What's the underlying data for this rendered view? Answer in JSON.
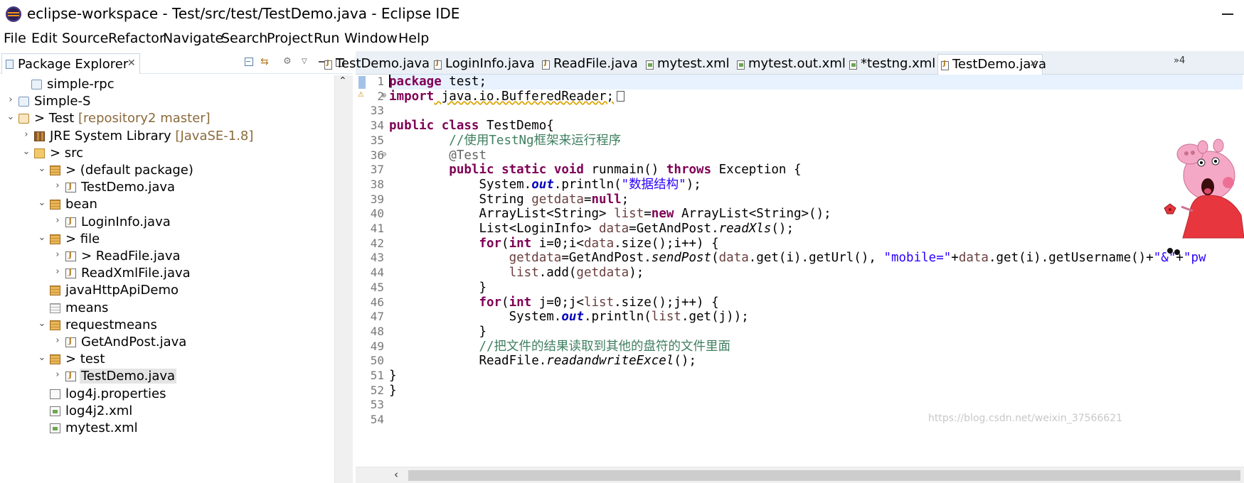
{
  "window": {
    "title": "eclipse-workspace - Test/src/test/TestDemo.java - Eclipse IDE"
  },
  "menu": [
    "File",
    "Edit",
    "Source",
    "Refactor",
    "Navigate",
    "Search",
    "Project",
    "Run",
    "Window",
    "Help"
  ],
  "explorer": {
    "tab_label": "Package Explorer",
    "close_glyph": "✕",
    "tree": [
      {
        "arrow": "",
        "label": "simple-rpc",
        "decor": "",
        "icon": "project"
      },
      {
        "arrow": "›",
        "label": "Simple-S",
        "decor": "",
        "icon": "project"
      },
      {
        "arrow": "⌄",
        "label": "> Test",
        "decor": " [repository2 master]",
        "icon": "project-git"
      },
      {
        "arrow": "›",
        "label": "JRE System Library",
        "decor": " [JavaSE-1.8]",
        "icon": "library"
      },
      {
        "arrow": "⌄",
        "label": "> src",
        "decor": "",
        "icon": "folder"
      },
      {
        "arrow": "⌄",
        "label": "> (default package)",
        "decor": "",
        "icon": "package"
      },
      {
        "arrow": "›",
        "label": "TestDemo.java",
        "decor": "",
        "icon": "java"
      },
      {
        "arrow": "⌄",
        "label": "bean",
        "decor": "",
        "icon": "package"
      },
      {
        "arrow": "›",
        "label": "LoginInfo.java",
        "decor": "",
        "icon": "java"
      },
      {
        "arrow": "⌄",
        "label": "> file",
        "decor": "",
        "icon": "package"
      },
      {
        "arrow": "›",
        "label": "> ReadFile.java",
        "decor": "",
        "icon": "java"
      },
      {
        "arrow": "›",
        "label": "ReadXmlFile.java",
        "decor": "",
        "icon": "java"
      },
      {
        "arrow": "",
        "label": "javaHttpApiDemo",
        "decor": "",
        "icon": "package"
      },
      {
        "arrow": "",
        "label": "means",
        "decor": "",
        "icon": "package-empty"
      },
      {
        "arrow": "⌄",
        "label": "requestmeans",
        "decor": "",
        "icon": "package"
      },
      {
        "arrow": "›",
        "label": "GetAndPost.java",
        "decor": "",
        "icon": "java"
      },
      {
        "arrow": "⌄",
        "label": "> test",
        "decor": "",
        "icon": "package"
      },
      {
        "arrow": "›",
        "label": "TestDemo.java",
        "decor": "",
        "icon": "java",
        "selected": true
      },
      {
        "arrow": "",
        "label": "log4j.properties",
        "decor": "",
        "icon": "file"
      },
      {
        "arrow": "",
        "label": "log4j2.xml",
        "decor": "",
        "icon": "xml"
      },
      {
        "arrow": "",
        "label": "mytest.xml",
        "decor": "",
        "icon": "xml"
      }
    ]
  },
  "editor": {
    "tabs": [
      {
        "label": "TestDemo.java",
        "icon": "java",
        "active": false
      },
      {
        "label": "LoginInfo.java",
        "icon": "java",
        "active": false
      },
      {
        "label": "ReadFile.java",
        "icon": "java",
        "active": false
      },
      {
        "label": "mytest.xml",
        "icon": "xml",
        "active": false
      },
      {
        "label": "mytest.out.xml",
        "icon": "xml",
        "active": false
      },
      {
        "label": "*testng.xml",
        "icon": "xml",
        "active": false
      },
      {
        "label": "TestDemo.java",
        "icon": "java",
        "active": true
      }
    ],
    "more_tabs": "»4",
    "line_numbers": [
      "1",
      "2",
      "33",
      "34",
      "35",
      "36",
      "37",
      "38",
      "39",
      "40",
      "41",
      "42",
      "43",
      "44",
      "45",
      "46",
      "47",
      "48",
      "49",
      "50",
      "51",
      "52",
      "53",
      "54"
    ],
    "code": {
      "l1_kw": "package",
      "l1_rest": " test;",
      "l2_kw": "import",
      "l2_rest": " java.io.BufferedReader;",
      "l34_kw1": "public",
      "l34_kw2": "class",
      "l34_rest": " TestDemo{",
      "l35_comment": "//使用TestNg框架来运行程序",
      "l36_annot": "@Test",
      "l37_kw1": "public",
      "l37_kw2": "static",
      "l37_kw3": "void",
      "l37_mid": " runmain() ",
      "l37_kw4": "throws",
      "l37_rest": " Exception {",
      "l38_a": "System.",
      "l38_field": "out",
      "l38_b": ".println(",
      "l38_str": "\"数据结构\"",
      "l38_c": ");",
      "l39_a": "String ",
      "l39_var": "getdata",
      "l39_b": "=",
      "l39_kw": "null",
      "l39_c": ";",
      "l40_a": "ArrayList<String> ",
      "l40_var": "list",
      "l40_b": "=",
      "l40_kw": "new",
      "l40_c": " ArrayList<String>();",
      "l41_a": "List<LoginInfo> ",
      "l41_var": "data",
      "l41_b": "=GetAndPost.",
      "l41_it": "readXls",
      "l41_c": "();",
      "l42_kw1": "for",
      "l42_a": "(",
      "l42_kw2": "int",
      "l42_b": " i=0;i<",
      "l42_var": "data",
      "l42_c": ".size();i++) {",
      "l43_var": "getdata",
      "l43_a": "=GetAndPost.",
      "l43_it": "sendPost",
      "l43_b": "(",
      "l43_var2": "data",
      "l43_c": ".get(i).getUrl(), ",
      "l43_str": "\"mobile=\"",
      "l43_d": "+",
      "l43_var3": "data",
      "l43_e": ".get(i).getUsername()+",
      "l43_str2": "\"&\"",
      "l43_f": "+",
      "l43_str3": "\"pw",
      "l44_var": "list",
      "l44_a": ".add(",
      "l44_var2": "getdata",
      "l44_b": ");",
      "l45": "}",
      "l46_kw1": "for",
      "l46_a": "(",
      "l46_kw2": "int",
      "l46_b": " j=0;j<",
      "l46_var": "list",
      "l46_c": ".size();j++) {",
      "l47_a": "System.",
      "l47_field": "out",
      "l47_b": ".println(",
      "l47_var": "list",
      "l47_c": ".get(j));",
      "l48": "}",
      "l49_comment": "//把文件的结果读取到其他的盘符的文件里面",
      "l50_a": "ReadFile.",
      "l50_it": "readandwriteExcel",
      "l50_b": "();",
      "l51": "}",
      "l52": "}"
    }
  },
  "scroll": {
    "left_glyph": "‹",
    "up_glyph": "⌃"
  },
  "watermark": "https://blog.csdn.net/weixin_37566621",
  "icons": {
    "app": "eclipse-logo-icon",
    "minimize": "minimize-icon",
    "sticker": "peppa-pig-sticker"
  }
}
